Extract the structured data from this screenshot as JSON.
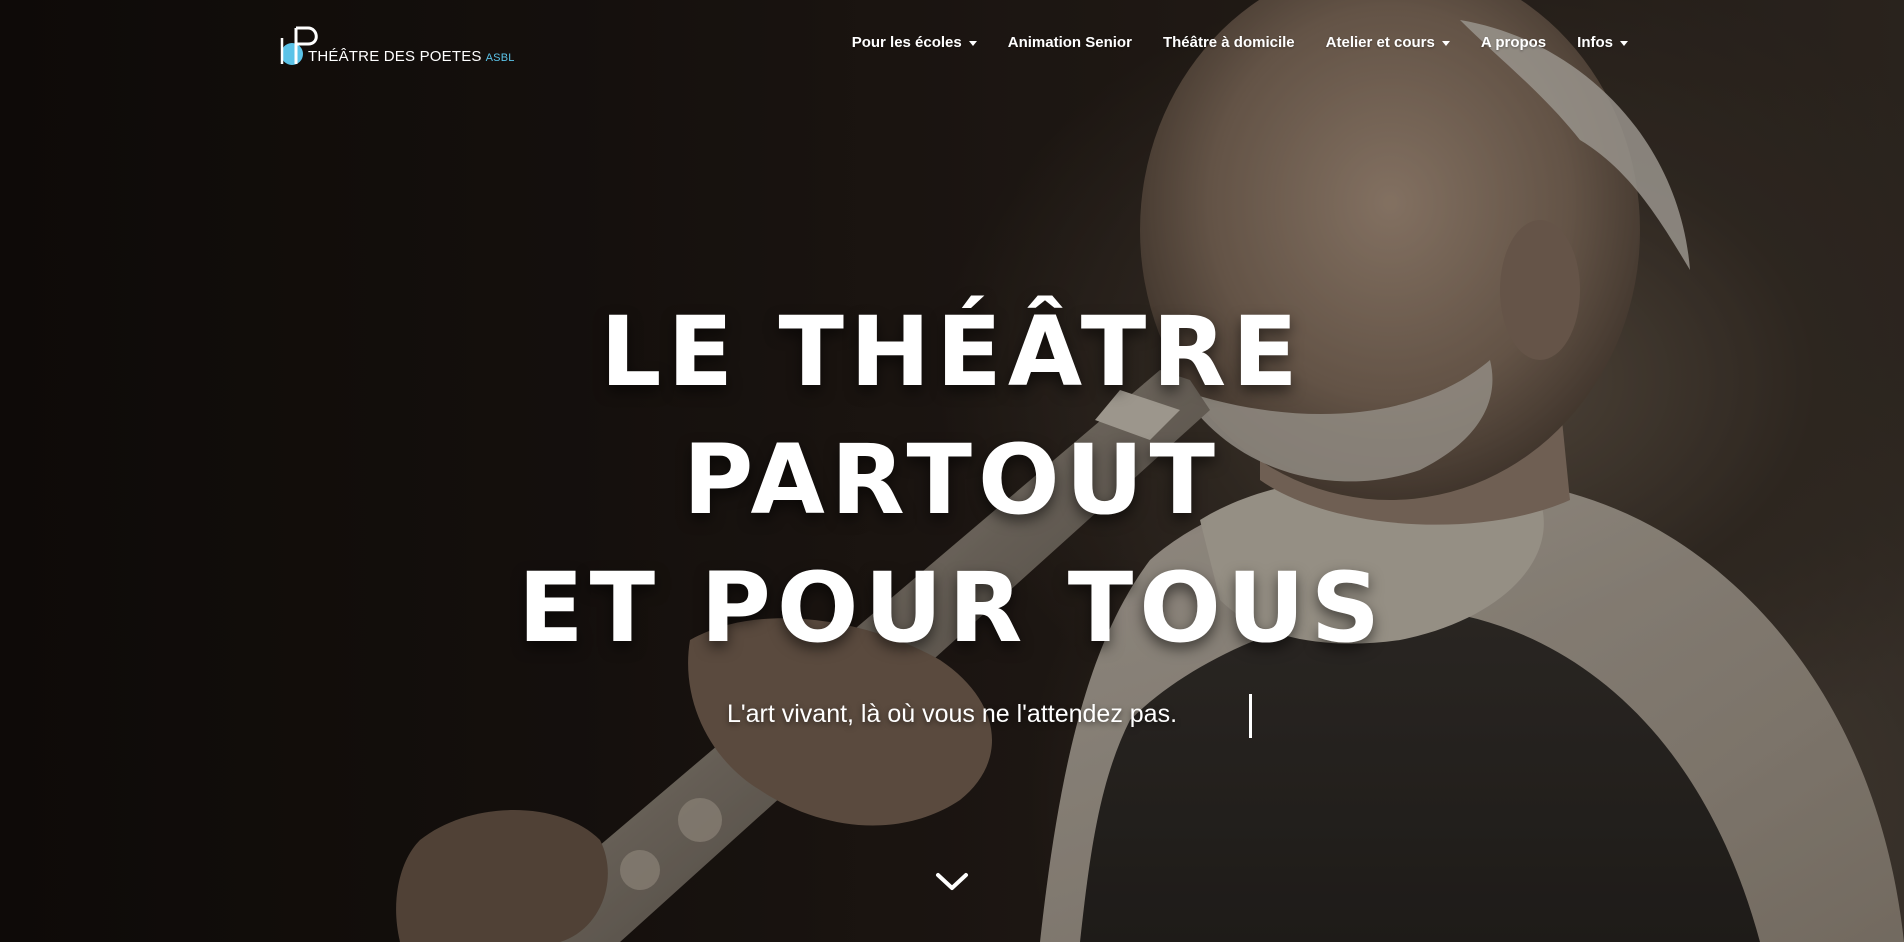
{
  "brand": {
    "name": "THÉÂTRE DES POETES",
    "suffix": "ASBL",
    "accent_color": "#5bc3e8"
  },
  "nav": {
    "items": [
      {
        "label": "Pour les écoles",
        "dropdown": true
      },
      {
        "label": "Animation Senior",
        "dropdown": false
      },
      {
        "label": "Théâtre à domicile",
        "dropdown": false
      },
      {
        "label": "Atelier et cours",
        "dropdown": true
      },
      {
        "label": "A propos",
        "dropdown": false
      },
      {
        "label": "Infos",
        "dropdown": true
      }
    ]
  },
  "hero": {
    "line1": "LE THÉÂTRE",
    "line2": "PARTOUT",
    "line3": "ET POUR TOUS",
    "tagline": "L'art vivant, là où vous ne l'attendez pas.",
    "scroll_icon": "chevron-down-icon"
  }
}
